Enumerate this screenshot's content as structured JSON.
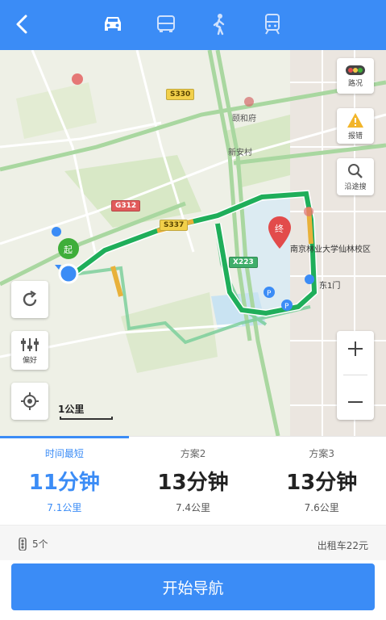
{
  "header": {
    "modes": [
      {
        "name": "car-icon"
      },
      {
        "name": "bus-icon"
      },
      {
        "name": "walk-icon"
      },
      {
        "name": "train-icon"
      }
    ]
  },
  "map": {
    "controls": {
      "traffic_label": "路况",
      "report_label": "报错",
      "search_label": "沿途搜",
      "preference_label": "偏好"
    },
    "labels": {
      "destination": "南京林业大学仙林校区",
      "gate": "东1门",
      "place1": "颐和府",
      "place2": "新安村",
      "road_s": "S330",
      "road_g": "G312",
      "road_s2": "S337",
      "road_x": "X223"
    },
    "scale": "1公里"
  },
  "routes": [
    {
      "name": "时间最短",
      "time": "11分钟",
      "distance": "7.1公里",
      "active": true
    },
    {
      "name": "方案2",
      "time": "13分钟",
      "distance": "7.4公里",
      "active": false
    },
    {
      "name": "方案3",
      "time": "13分钟",
      "distance": "7.6公里",
      "active": false
    }
  ],
  "info": {
    "traffic_lights": "5个",
    "taxi_fare": "出租车22元"
  },
  "start_button": "开始导航",
  "colors": {
    "accent": "#3b8cf6",
    "route_main": "#1fae5a",
    "route_alt": "#6fc98f"
  }
}
